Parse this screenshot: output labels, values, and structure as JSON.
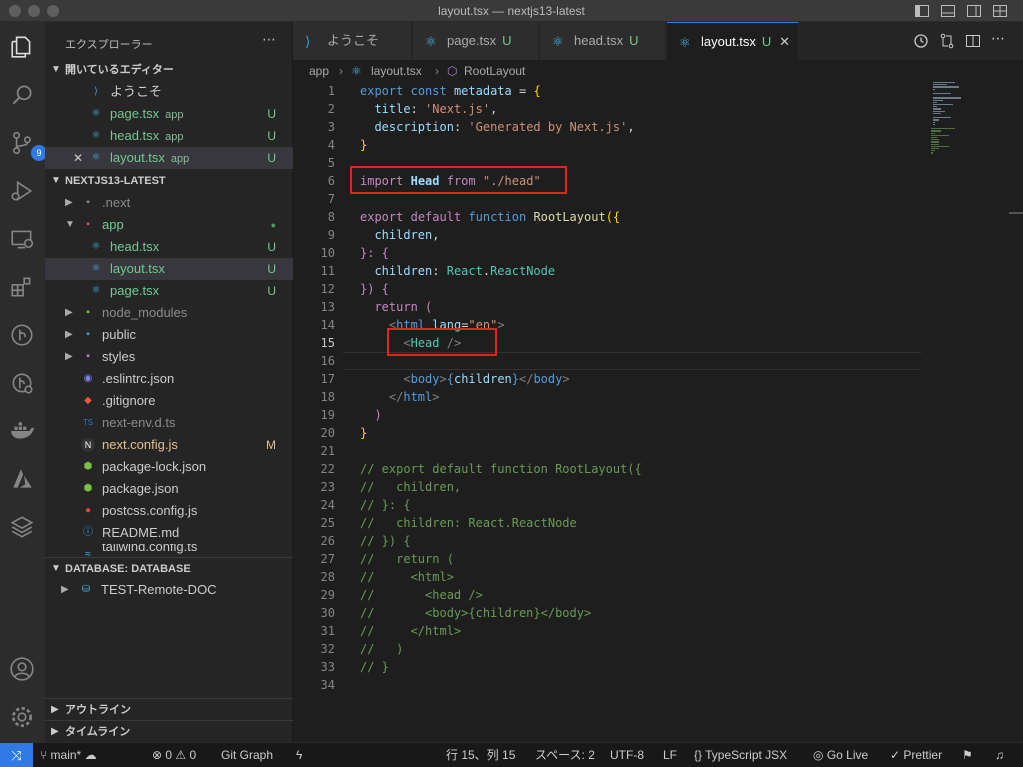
{
  "window": {
    "title": "layout.tsx — nextjs13-latest"
  },
  "activity": {
    "scm_badge": "9"
  },
  "sidebar": {
    "title": "エクスプローラー",
    "open_editors": {
      "header": "開いているエディター",
      "items": [
        {
          "label": "ようこそ",
          "sub": "",
          "status": ""
        },
        {
          "label": "page.tsx",
          "sub": "app",
          "status": "U"
        },
        {
          "label": "head.tsx",
          "sub": "app",
          "status": "U"
        },
        {
          "label": "layout.tsx",
          "sub": "app",
          "status": "U"
        }
      ]
    },
    "project": {
      "header": "NEXTJS13-LATEST",
      "items": [
        {
          "label": ".next",
          "status": ""
        },
        {
          "label": "app",
          "status": "●"
        },
        {
          "label": "head.tsx",
          "status": "U"
        },
        {
          "label": "layout.tsx",
          "status": "U"
        },
        {
          "label": "page.tsx",
          "status": "U"
        },
        {
          "label": "node_modules",
          "status": ""
        },
        {
          "label": "public",
          "status": ""
        },
        {
          "label": "styles",
          "status": ""
        },
        {
          "label": ".eslintrc.json",
          "status": ""
        },
        {
          "label": ".gitignore",
          "status": ""
        },
        {
          "label": "next-env.d.ts",
          "status": ""
        },
        {
          "label": "next.config.js",
          "status": "M"
        },
        {
          "label": "package-lock.json",
          "status": ""
        },
        {
          "label": "package.json",
          "status": ""
        },
        {
          "label": "postcss.config.js",
          "status": ""
        },
        {
          "label": "README.md",
          "status": ""
        },
        {
          "label": "tailwind.config.ts",
          "status": ""
        }
      ]
    },
    "database": {
      "header": "DATABASE: DATABASE",
      "item": "TEST-Remote-DOC"
    },
    "outline": "アウトライン",
    "timeline": "タイムライン"
  },
  "tabs": [
    {
      "label": "ようこそ",
      "status": ""
    },
    {
      "label": "page.tsx",
      "status": "U"
    },
    {
      "label": "head.tsx",
      "status": "U"
    },
    {
      "label": "layout.tsx",
      "status": "U"
    }
  ],
  "breadcrumb": {
    "folder": "app",
    "file": "layout.tsx",
    "symbol": "RootLayout"
  },
  "code_lines": [
    "1",
    "2",
    "3",
    "4",
    "5",
    "6",
    "7",
    "8",
    "9",
    "10",
    "11",
    "12",
    "13",
    "14",
    "15",
    "16",
    "17",
    "18",
    "19",
    "20",
    "21",
    "22",
    "23",
    "24",
    "25",
    "26",
    "27",
    "28",
    "29",
    "30",
    "31",
    "32",
    "33",
    "34"
  ],
  "code": {
    "l1": [
      "export",
      "const",
      "metadata",
      "=",
      "{"
    ],
    "l2": [
      "title",
      ":",
      "'Next.js'",
      ","
    ],
    "l3": [
      "description",
      ":",
      "'Generated by Next.js'",
      ","
    ],
    "l4": "}",
    "l6": [
      "import",
      "Head",
      "from",
      "\"./head\""
    ],
    "l8": [
      "export",
      "default",
      "function",
      "RootLayout",
      "({"
    ],
    "l9": [
      "children",
      ","
    ],
    "l10": "}: {",
    "l11": [
      "children",
      ":",
      "React",
      ".",
      "ReactNode"
    ],
    "l12": "}) {",
    "l13": [
      "return",
      "("
    ],
    "l14": [
      "<",
      "html",
      "lang",
      "=",
      "\"en\"",
      ">"
    ],
    "l15": [
      "<",
      "Head",
      "/>"
    ],
    "l17": [
      "<",
      "body",
      ">",
      "{",
      "children",
      "}",
      "</",
      "body",
      ">"
    ],
    "l18": [
      "</",
      "html",
      ">"
    ],
    "l19": ")",
    "l20": "}",
    "c22": "// export default function RootLayout({",
    "c23": "//   children,",
    "c24": "// }: {",
    "c25": "//   children: React.ReactNode",
    "c26": "// }) {",
    "c27": "//   return (",
    "c28": "//     <html>",
    "c29": "//       <head />",
    "c30": "//       <body>{children}</body>",
    "c31": "//     </html>",
    "c32": "//   )",
    "c33": "// }"
  },
  "status": {
    "branch": "main*",
    "errors": "0",
    "warnings": "0",
    "git_graph": "Git Graph",
    "position": "行 15、列 15",
    "spaces": "スペース: 2",
    "encoding": "UTF-8",
    "eol": "LF",
    "language": "TypeScript JSX",
    "golive": "Go Live",
    "prettier": "Prettier"
  },
  "colors": {
    "accent": "#2f7ae5",
    "highlight_box": "#e0261d",
    "untracked": "#73c991",
    "modified": "#e2c08d"
  }
}
